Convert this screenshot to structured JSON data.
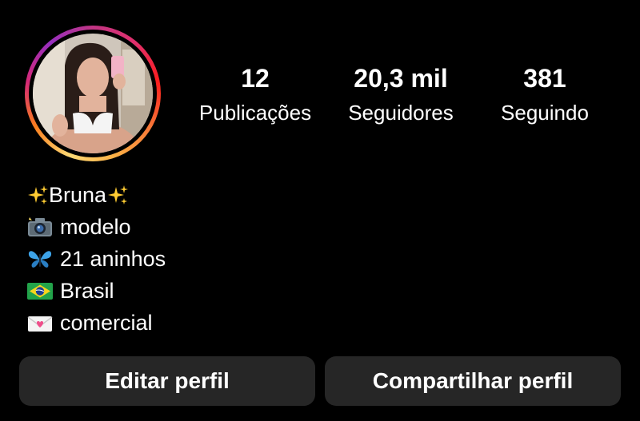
{
  "profile": {
    "stats": [
      {
        "value": "12",
        "label": "Publicações"
      },
      {
        "value": "20,3 mil",
        "label": "Seguidores"
      },
      {
        "value": "381",
        "label": "Seguindo"
      }
    ],
    "bio": {
      "name": "Bruna",
      "lines": [
        {
          "icon": "camera-with-flash-icon",
          "text": "modelo"
        },
        {
          "icon": "butterfly-icon",
          "text": "21 aninhos"
        },
        {
          "icon": "brazil-flag-icon",
          "text": "Brasil"
        },
        {
          "icon": "love-letter-icon",
          "text": "comercial"
        }
      ]
    },
    "buttons": {
      "edit": "Editar perfil",
      "share": "Compartilhar perfil"
    }
  },
  "colors": {
    "background": "#000000",
    "button_bg": "#262626",
    "text": "#ffffff"
  }
}
